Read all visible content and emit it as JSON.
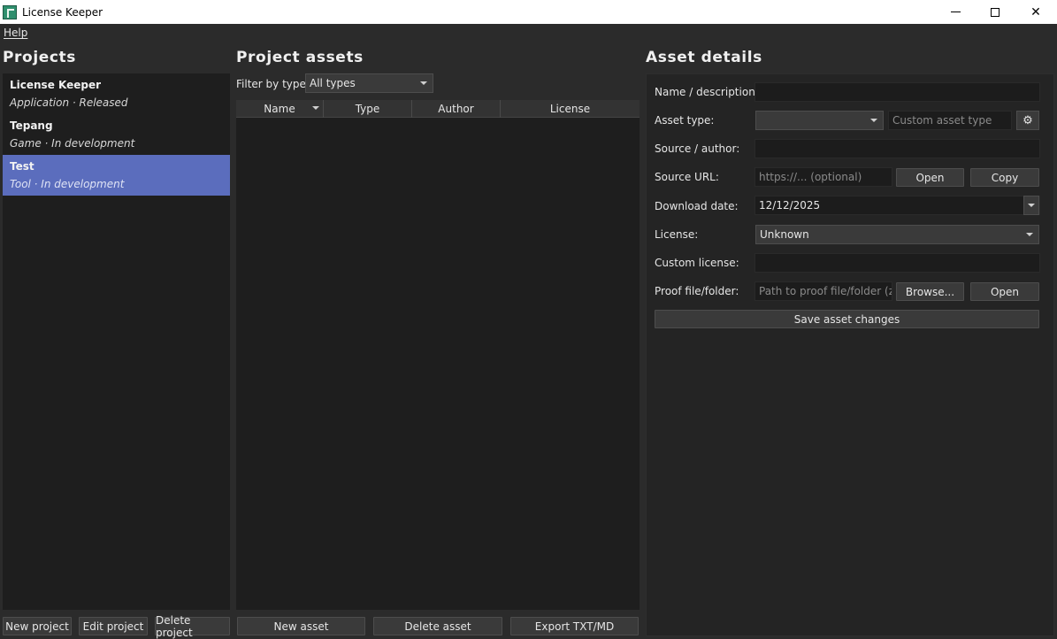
{
  "window": {
    "title": "License Keeper"
  },
  "menu": {
    "help": "Help"
  },
  "projects": {
    "heading": "Projects",
    "items": [
      {
        "name": "License Keeper",
        "meta": "Application · Released",
        "selected": false
      },
      {
        "name": "Tepang",
        "meta": "Game · In development",
        "selected": false
      },
      {
        "name": "Test",
        "meta": "Tool · In development",
        "selected": true
      }
    ],
    "buttons": {
      "new": "New project",
      "edit": "Edit project",
      "delete": "Delete project"
    }
  },
  "assets": {
    "heading": "Project assets",
    "filter_label": "Filter by type:",
    "filter_value": "All types",
    "columns": [
      "Name",
      "Type",
      "Author",
      "License"
    ],
    "rows": [],
    "buttons": {
      "new": "New asset",
      "delete": "Delete asset",
      "export": "Export TXT/MD"
    }
  },
  "details": {
    "heading": "Asset details",
    "labels": {
      "name": "Name / description:",
      "asset_type": "Asset type:",
      "source": "Source / author:",
      "url": "Source URL:",
      "date": "Download date:",
      "license": "License:",
      "custom_license": "Custom license:",
      "proof": "Proof file/folder:"
    },
    "values": {
      "name": "",
      "asset_type": "",
      "source": "",
      "url": "",
      "date": "12/12/2025",
      "license": "Unknown",
      "custom_license": "",
      "proof": ""
    },
    "placeholders": {
      "custom_asset_type": "Custom asset type",
      "url": "https://... (optional)",
      "proof": "Path to proof file/folder (z..."
    },
    "buttons": {
      "url_open": "Open",
      "url_copy": "Copy",
      "browse": "Browse...",
      "proof_open": "Open",
      "save": "Save asset changes"
    },
    "icons": {
      "asset_type_settings": "gear-icon"
    }
  },
  "colors": {
    "background": "#2b2b2b",
    "panel": "#1e1e1e",
    "selection": "#5b6dbd",
    "titlebar": "#ffffff"
  }
}
